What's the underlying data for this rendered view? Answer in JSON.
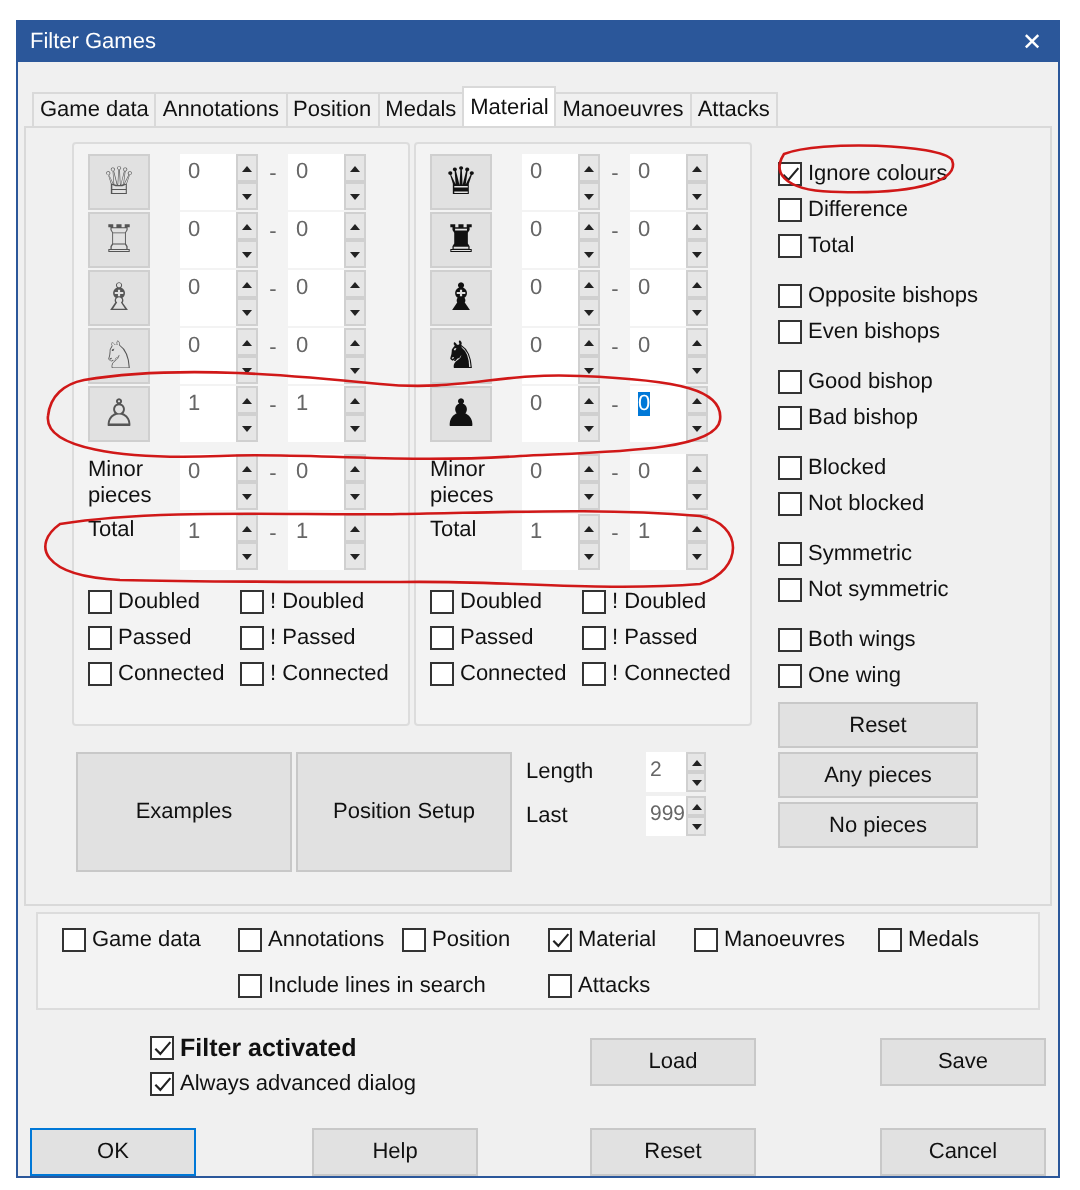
{
  "window": {
    "title": "Filter Games",
    "close": "✕"
  },
  "tabs": [
    {
      "label": "Game data",
      "selected": false
    },
    {
      "label": "Annotations",
      "selected": false
    },
    {
      "label": "Position",
      "selected": false
    },
    {
      "label": "Medals",
      "selected": false
    },
    {
      "label": "Material",
      "selected": true
    },
    {
      "label": "Manoeuvres",
      "selected": false
    },
    {
      "label": "Attacks",
      "selected": false
    }
  ],
  "material": [
    {
      "rows": [
        {
          "kind": "piece",
          "piece": "♕",
          "min": {
            "value": "0",
            "selected": false
          },
          "dash": "-",
          "max": {
            "value": "0",
            "selected": false
          }
        },
        {
          "kind": "piece",
          "piece": "♖",
          "min": {
            "value": "0",
            "selected": false
          },
          "dash": "-",
          "max": {
            "value": "0",
            "selected": false
          }
        },
        {
          "kind": "piece",
          "piece": "♗",
          "min": {
            "value": "0",
            "selected": false
          },
          "dash": "-",
          "max": {
            "value": "0",
            "selected": false
          }
        },
        {
          "kind": "piece",
          "piece": "♘",
          "min": {
            "value": "0",
            "selected": false
          },
          "dash": "-",
          "max": {
            "value": "0",
            "selected": false
          }
        },
        {
          "kind": "piece",
          "piece": "♙",
          "min": {
            "value": "1",
            "selected": false
          },
          "dash": "-",
          "max": {
            "value": "1",
            "selected": false
          }
        },
        {
          "kind": "label",
          "label": "Minor pieces",
          "min": {
            "value": "0",
            "selected": false
          },
          "dash": "-",
          "max": {
            "value": "0",
            "selected": false
          }
        },
        {
          "kind": "label",
          "label": "Total",
          "min": {
            "value": "1",
            "selected": false
          },
          "dash": "-",
          "max": {
            "value": "1",
            "selected": false
          }
        }
      ],
      "checks": [
        {
          "label": "Doubled",
          "checked": false
        },
        {
          "label": "! Doubled",
          "checked": false
        },
        {
          "label": "Passed",
          "checked": false
        },
        {
          "label": "! Passed",
          "checked": false
        },
        {
          "label": "Connected",
          "checked": false
        },
        {
          "label": "! Connected",
          "checked": false
        }
      ]
    },
    {
      "rows": [
        {
          "kind": "piece",
          "piece": "♛",
          "min": {
            "value": "0",
            "selected": false
          },
          "dash": "-",
          "max": {
            "value": "0",
            "selected": false
          }
        },
        {
          "kind": "piece",
          "piece": "♜",
          "min": {
            "value": "0",
            "selected": false
          },
          "dash": "-",
          "max": {
            "value": "0",
            "selected": false
          }
        },
        {
          "kind": "piece",
          "piece": "♝",
          "min": {
            "value": "0",
            "selected": false
          },
          "dash": "-",
          "max": {
            "value": "0",
            "selected": false
          }
        },
        {
          "kind": "piece",
          "piece": "♞",
          "min": {
            "value": "0",
            "selected": false
          },
          "dash": "-",
          "max": {
            "value": "0",
            "selected": false
          }
        },
        {
          "kind": "piece",
          "piece": "♟",
          "min": {
            "value": "0",
            "selected": false
          },
          "dash": "-",
          "max": {
            "value": "0",
            "selected": true
          }
        },
        {
          "kind": "label",
          "label": "Minor pieces",
          "min": {
            "value": "0",
            "selected": false
          },
          "dash": "-",
          "max": {
            "value": "0",
            "selected": false
          }
        },
        {
          "kind": "label",
          "label": "Total",
          "min": {
            "value": "1",
            "selected": false
          },
          "dash": "-",
          "max": {
            "value": "1",
            "selected": false
          }
        }
      ],
      "checks": [
        {
          "label": "Doubled",
          "checked": false
        },
        {
          "label": "! Doubled",
          "checked": false
        },
        {
          "label": "Passed",
          "checked": false
        },
        {
          "label": "! Passed",
          "checked": false
        },
        {
          "label": "Connected",
          "checked": false
        },
        {
          "label": "! Connected",
          "checked": false
        }
      ]
    }
  ],
  "options": [
    [
      {
        "label": "Ignore colours",
        "checked": true
      },
      {
        "label": "Difference",
        "checked": false
      },
      {
        "label": "Total",
        "checked": false
      }
    ],
    [
      {
        "label": "Opposite bishops",
        "checked": false
      },
      {
        "label": "Even bishops",
        "checked": false
      }
    ],
    [
      {
        "label": "Good bishop",
        "checked": false
      },
      {
        "label": "Bad bishop",
        "checked": false
      }
    ],
    [
      {
        "label": "Blocked",
        "checked": false
      },
      {
        "label": "Not blocked",
        "checked": false
      }
    ],
    [
      {
        "label": "Symmetric",
        "checked": false
      },
      {
        "label": "Not symmetric",
        "checked": false
      }
    ],
    [
      {
        "label": "Both wings",
        "checked": false
      },
      {
        "label": "One wing",
        "checked": false
      }
    ]
  ],
  "big_buttons": [
    "Examples",
    "Position Setup"
  ],
  "length_fields": [
    {
      "label": "Length",
      "value": "2"
    },
    {
      "label": "Last",
      "value": "999"
    }
  ],
  "side_buttons": [
    "Reset",
    "Any pieces",
    "No pieces"
  ],
  "scope": [
    [
      {
        "label": "Game data",
        "checked": false
      },
      {
        "label": "Annotations",
        "checked": false
      },
      {
        "label": "Position",
        "checked": false
      },
      {
        "label": "Material",
        "checked": true
      },
      {
        "label": "Manoeuvres",
        "checked": false
      },
      {
        "label": "Medals",
        "checked": false
      }
    ],
    [
      {
        "label": "Include lines in search",
        "checked": false
      },
      {
        "label": "Attacks",
        "checked": false
      }
    ]
  ],
  "footer_checks": [
    {
      "label": "Filter activated",
      "checked": true
    },
    {
      "label": "Always advanced dialog",
      "checked": true
    }
  ],
  "top_buttons": [
    "Load",
    "Save"
  ],
  "bottom_buttons": [
    {
      "label": "OK",
      "default": true
    },
    {
      "label": "Help",
      "default": false
    },
    {
      "label": "Reset",
      "default": false
    },
    {
      "label": "Cancel",
      "default": false
    }
  ]
}
